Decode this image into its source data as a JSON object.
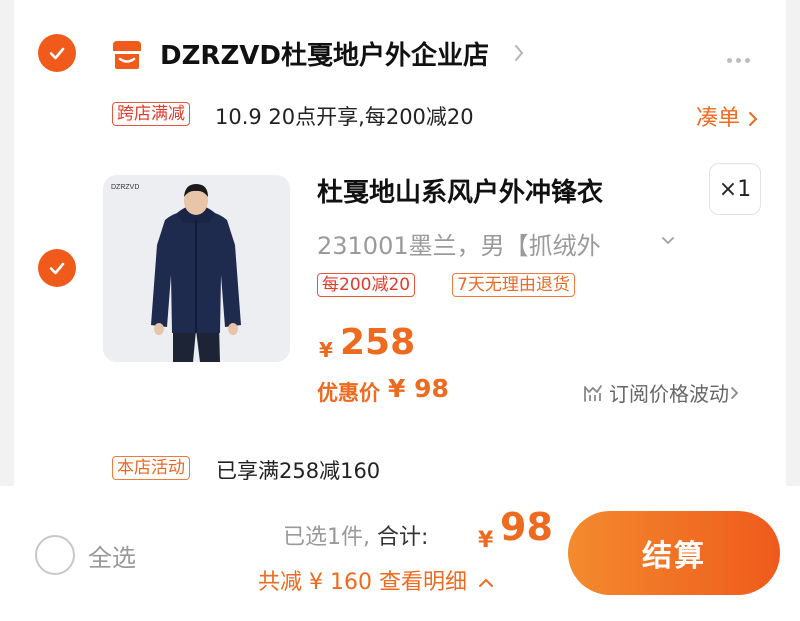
{
  "store": {
    "name": "DZRZVD杜戛地户外企业店",
    "promo_tag": "跨店满减",
    "promo_text": "10.9 20点开享,每200减20",
    "cou_dan": "凑单"
  },
  "product": {
    "title": "杜戛地山系风户外冲锋衣",
    "quantity": "×1",
    "sku": "231001墨兰，男【抓绒外",
    "tags": [
      "每200减20",
      "7天无理由退货"
    ],
    "price_symbol": "¥",
    "price": "258",
    "discount_label": "优惠价",
    "discount_price": "¥ 98",
    "subscribe": "订阅价格波动",
    "image_brand": "DZRZVD"
  },
  "activity": {
    "tag": "本店活动",
    "text": "已享满258减160"
  },
  "footer": {
    "select_all": "全选",
    "selected_count": "已选1件,",
    "total_label": "合计:",
    "total_symbol": "¥",
    "total_value": "98",
    "saved": "共减 ¥ 160  查看明细",
    "checkout": "结算"
  },
  "colors": {
    "accent": "#ee6a1f",
    "check": "#f05a1a",
    "tag_red": "#e33a2b"
  }
}
